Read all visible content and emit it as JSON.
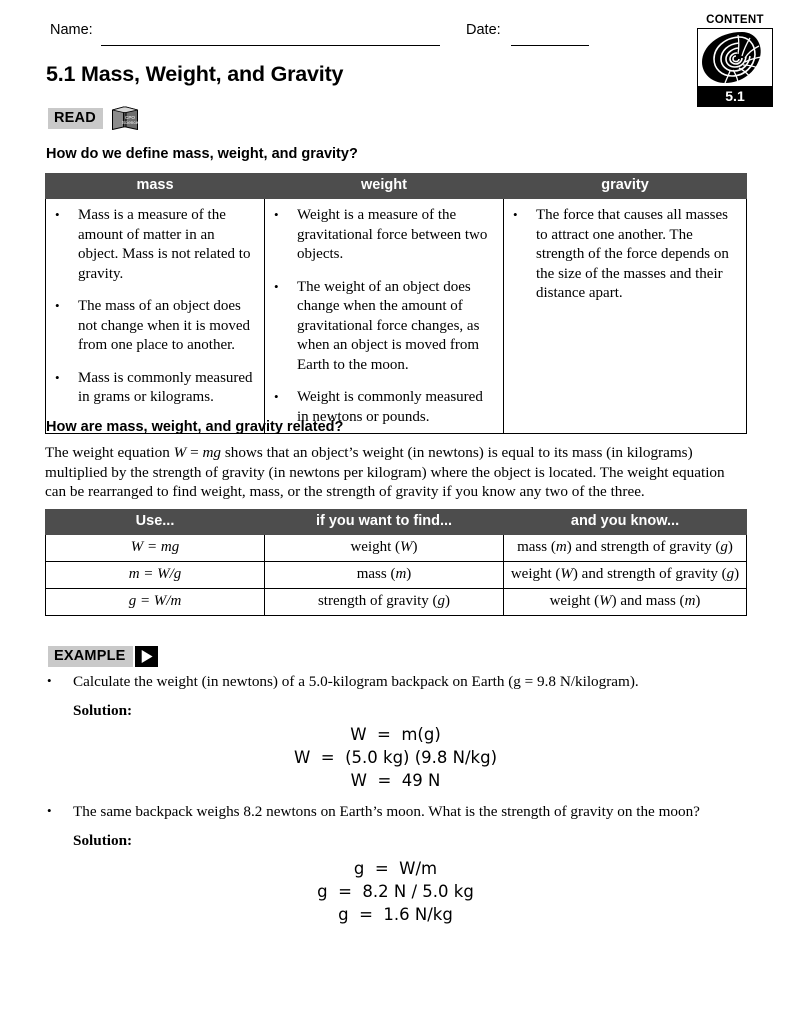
{
  "header": {
    "name_label": "Name:",
    "date_label": "Date:",
    "name_value": "",
    "date_value": "",
    "badge": {
      "caption": "CONTENT",
      "number": "5.1",
      "art_icon": "nautilus-shell-icon"
    }
  },
  "title": "5.1 Mass, Weight, and Gravity",
  "tags": {
    "read": {
      "label": "READ",
      "icon": "book-icon",
      "book_line1": "CPO",
      "book_line2": "Science"
    },
    "example": {
      "label": "EXAMPLE",
      "icon": "play-triangle-icon"
    }
  },
  "sections": {
    "heading_1": "How do we define mass, weight, and gravity?",
    "heading_2": "How are mass, weight, and gravity related?"
  },
  "definitions_table": {
    "headers": [
      "mass",
      "weight",
      "gravity"
    ],
    "columns": [
      [
        "Mass is a measure of the amount of matter in an object. Mass is not related to gravity.",
        "The mass of an object does not change when it is moved from one place to another.",
        "Mass is commonly measured in grams or kilograms."
      ],
      [
        "Weight is a measure of the gravitational force between two objects.",
        "The weight of an object does change when the amount of gravitational force changes, as when an object is moved from Earth to the moon.",
        "Weight is commonly measured in newtons or pounds."
      ],
      [
        "The force that causes all masses to attract one another. The strength of the force depends on the size of the masses and their distance apart."
      ]
    ]
  },
  "body_paragraph": {
    "part1": "The weight equation ",
    "eq_W": "W",
    "eq_eq": " = ",
    "eq_mg": "mg",
    "part2": " shows that an object’s weight (in newtons) is equal to its mass (in kilograms) multiplied by the strength of gravity (in newtons per kilogram) where the object is located. The weight equation can be rearranged to find weight, mass, or the strength of gravity if you know any two of the three."
  },
  "equation_table": {
    "headers": [
      "Use...",
      "if you want to find...",
      "and you know..."
    ],
    "rows": [
      [
        "W = mg",
        "weight (W)",
        "mass (m) and strength of gravity (g)"
      ],
      [
        "m = W/g",
        "mass (m)",
        "weight (W) and strength of gravity (g)"
      ],
      [
        "g = W/m",
        "strength of gravity (g)",
        "weight (W) and mass (m)"
      ]
    ]
  },
  "examples": [
    {
      "prompt": "Calculate the weight (in newtons) of a 5.0-kilogram backpack on Earth (g = 9.8 N/kilogram).",
      "solution_label": "Solution:",
      "equations": [
        "W  =  m(g)",
        "W  =  (5.0 kg) (9.8 N/kg)",
        "W  =  49 N"
      ]
    },
    {
      "prompt": "The same backpack weighs 8.2 newtons on Earth’s moon. What is the strength of gravity on the moon?",
      "solution_label": "Solution:",
      "equations": [
        "g  =  W/m",
        "g  =  8.2 N / 5.0 kg",
        "g  =  1.6 N/kg"
      ]
    }
  ],
  "colors": {
    "table_header_bg": "#4d4d4d",
    "tag_bg": "#c9c9c9",
    "text": "#000000",
    "page_bg": "#ffffff"
  }
}
